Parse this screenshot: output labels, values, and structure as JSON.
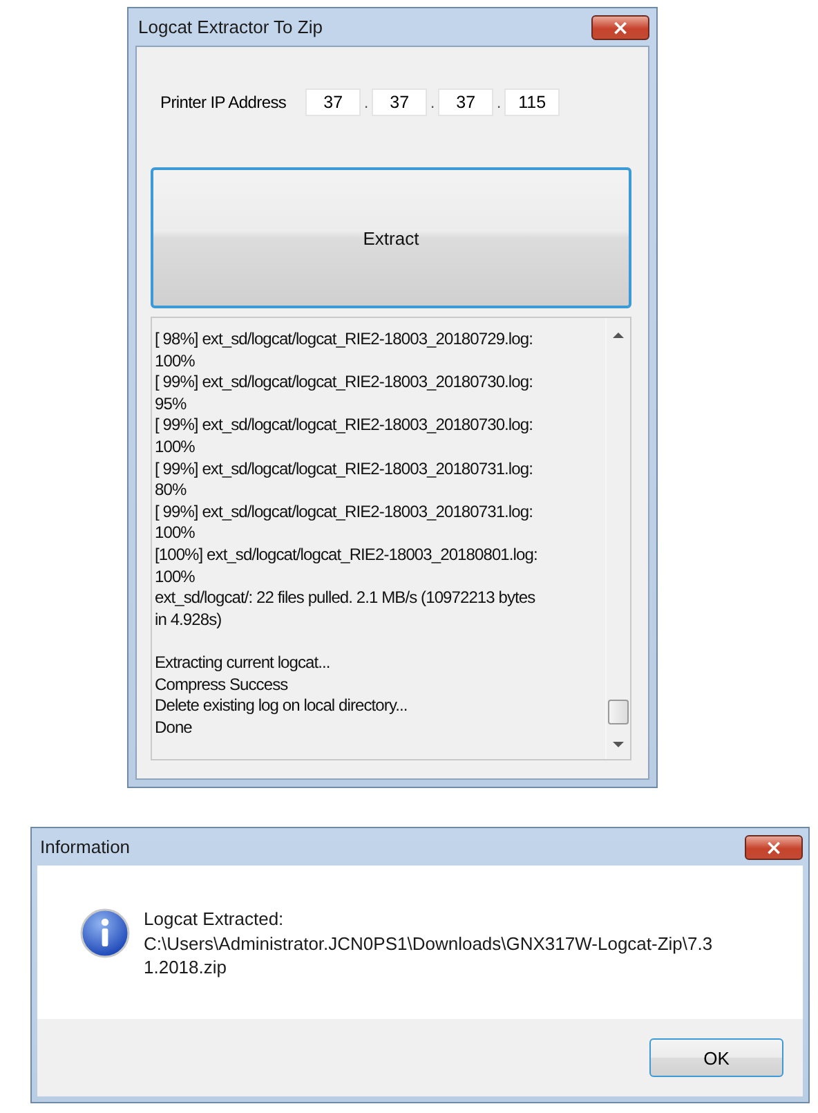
{
  "main_window": {
    "title": "Logcat Extractor To Zip",
    "close": "×",
    "ip_label": "Printer IP Address",
    "ip_octets": [
      "37",
      "37",
      "37",
      "115"
    ],
    "ip_separator": ".",
    "extract_button": "Extract",
    "log_blocks": [
      [
        "[ 98%] ext_sd/logcat/logcat_RIE2-18003_20180729.log:",
        "100%",
        "[ 99%] ext_sd/logcat/logcat_RIE2-18003_20180730.log:",
        "95%",
        "[ 99%] ext_sd/logcat/logcat_RIE2-18003_20180730.log:",
        "100%",
        "[ 99%] ext_sd/logcat/logcat_RIE2-18003_20180731.log:",
        "80%",
        "[ 99%] ext_sd/logcat/logcat_RIE2-18003_20180731.log:",
        "100%",
        "[100%] ext_sd/logcat/logcat_RIE2-18003_20180801.log:",
        "100%",
        "ext_sd/logcat/: 22 files pulled. 2.1 MB/s (10972213 bytes",
        "in 4.928s)"
      ],
      [
        "Extracting current logcat...",
        "Compress Success",
        "Delete existing log on local directory...",
        "Done"
      ]
    ]
  },
  "dialog": {
    "title": "Information",
    "close": "×",
    "message_lines": [
      "Logcat Extracted:",
      "C:\\Users\\Administrator.JCN0PS1\\Downloads\\GNX317W-Logcat-Zip\\7.3",
      "1.2018.zip"
    ],
    "ok_button": "OK"
  }
}
